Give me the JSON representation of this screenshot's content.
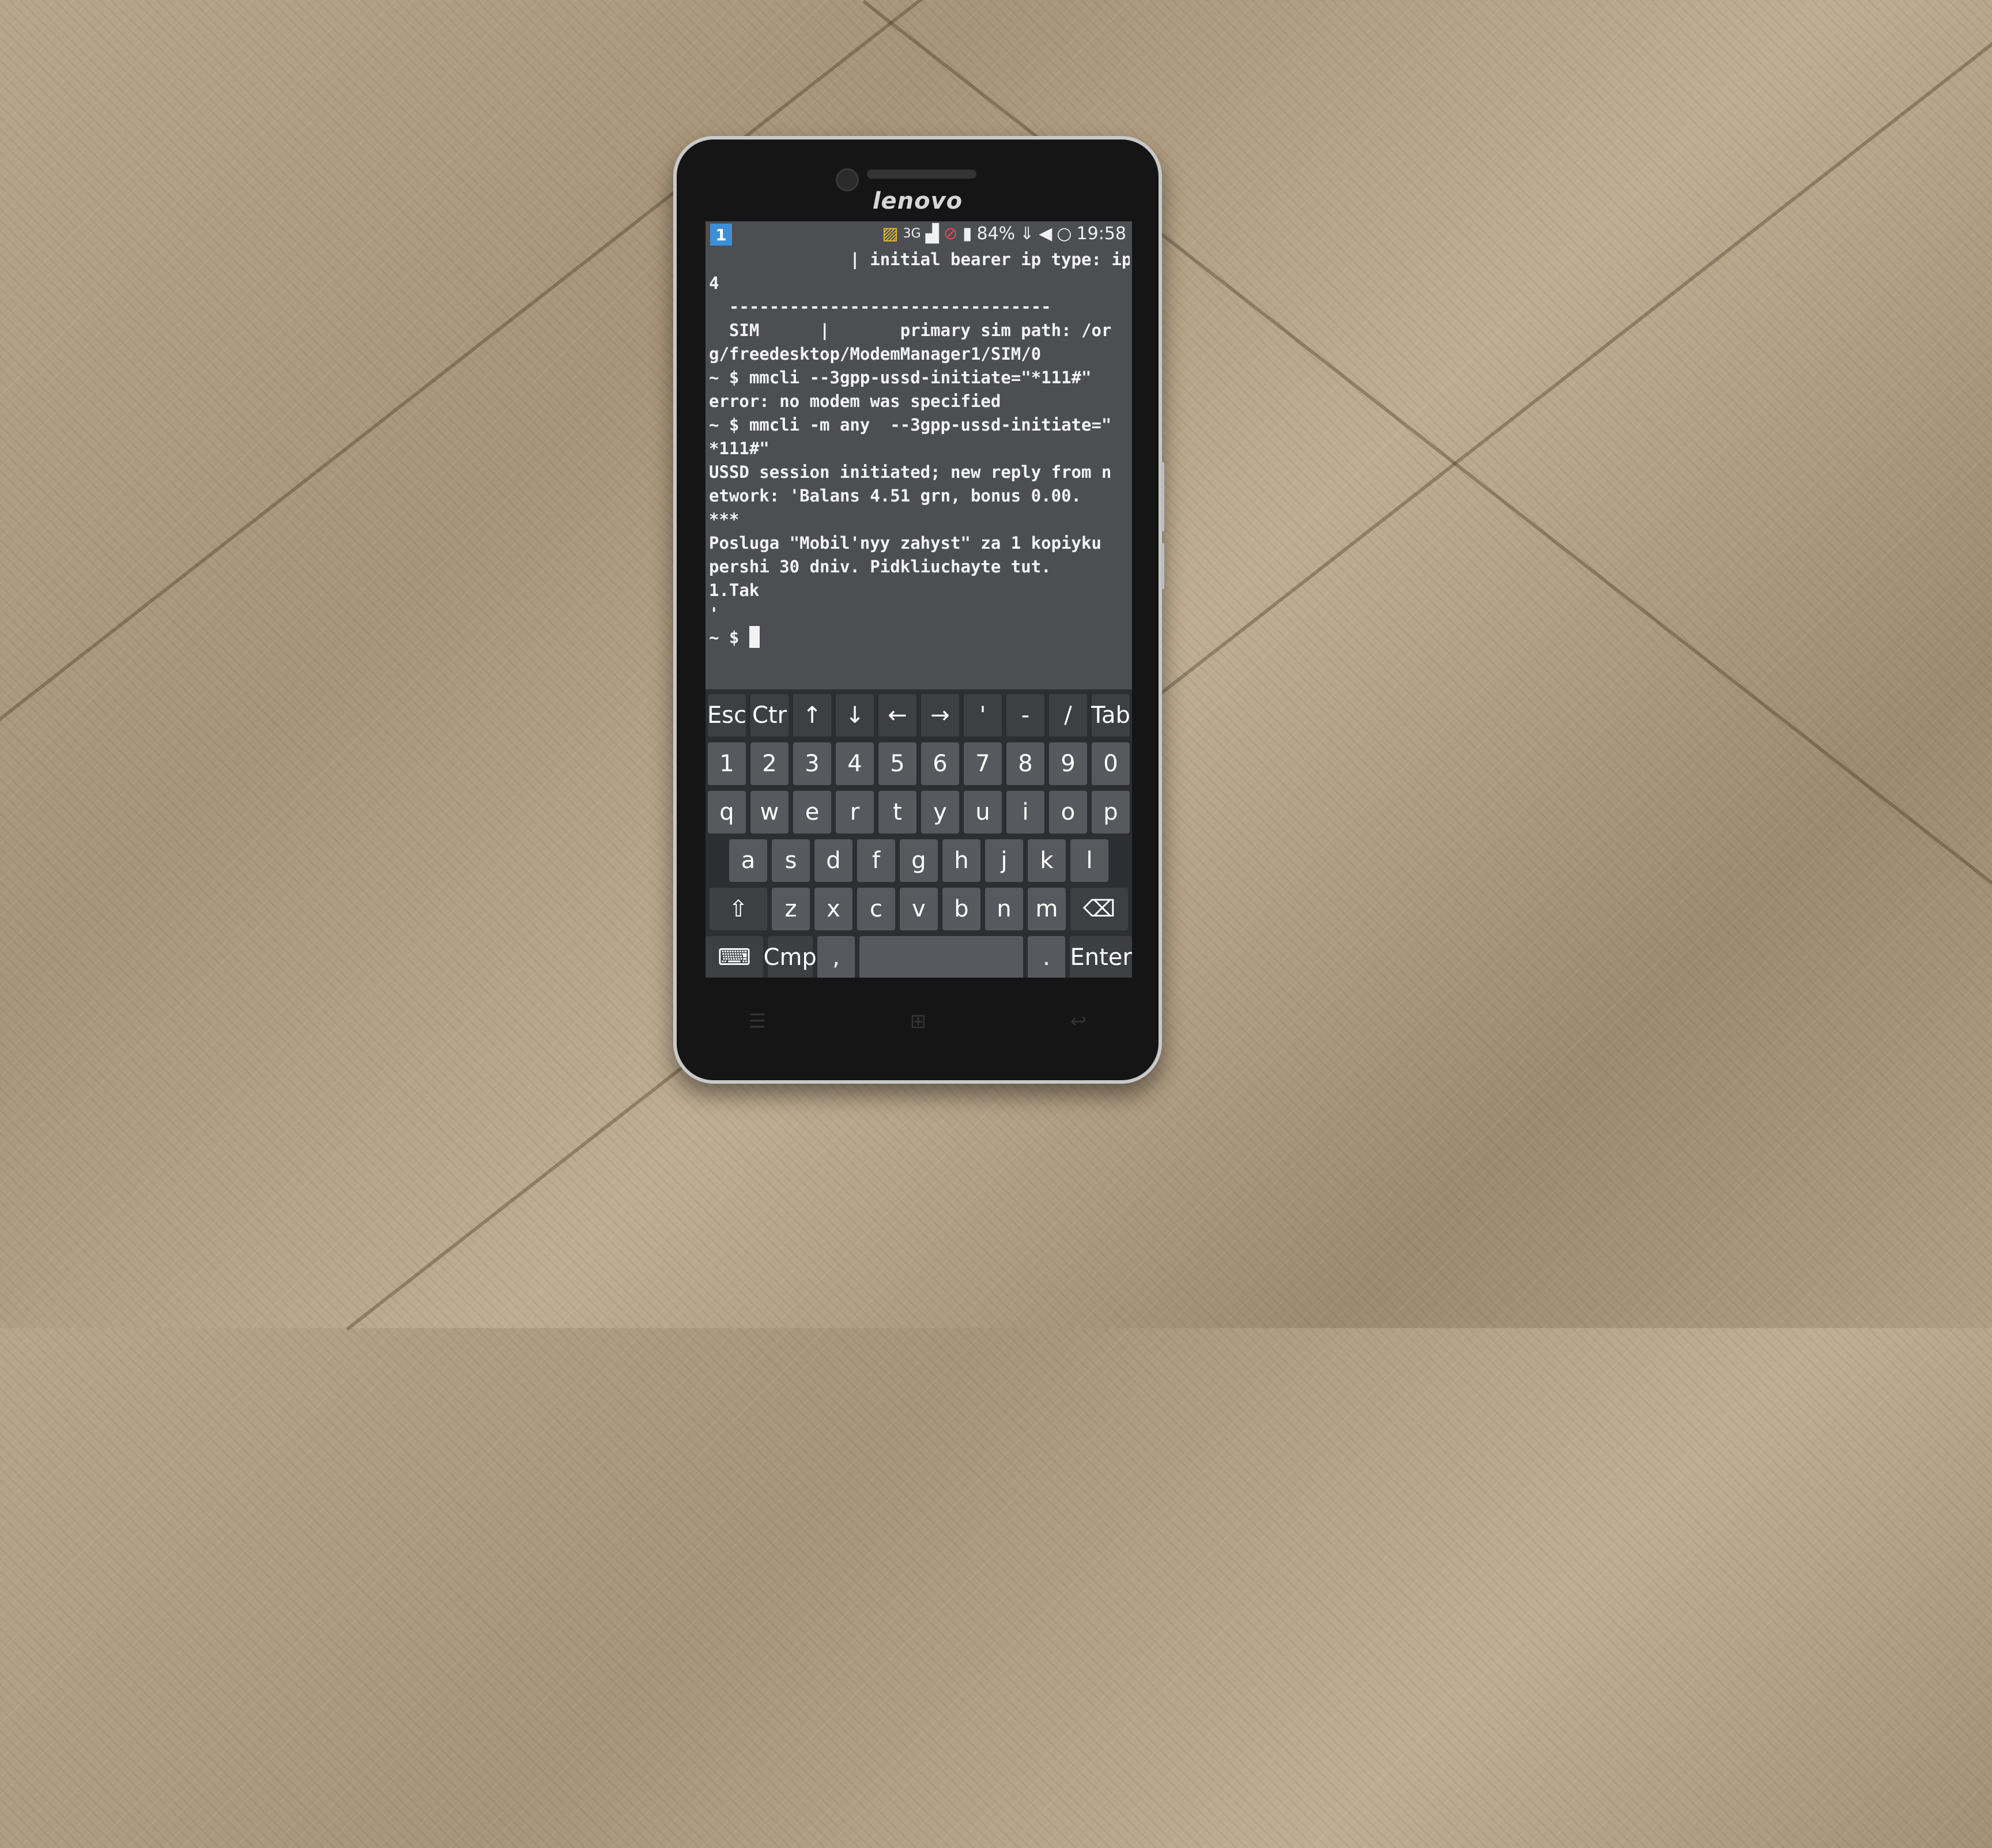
{
  "phone": {
    "brand": "lenovo"
  },
  "statusbar": {
    "window_number": "1",
    "network": "3G",
    "battery": "84%",
    "time": "19:58"
  },
  "terminal": {
    "lines": [
      "              | initial bearer ip type: ipv",
      "4",
      "  --------------------------------",
      "  SIM      |       primary sim path: /or",
      "g/freedesktop/ModemManager1/SIM/0",
      "~ $ mmcli --3gpp-ussd-initiate=\"*111#\"",
      "error: no modem was specified",
      "~ $ mmcli -m any  --3gpp-ussd-initiate=\"",
      "*111#\"",
      "USSD session initiated; new reply from n",
      "etwork: 'Balans 4.51 grn, bonus 0.00.",
      "***",
      "Posluga \"Mobil'nyy zahyst\" za 1 kopiyku",
      "pershi 30 dniv. Pidkliuchayte tut.",
      "1.Tak",
      "'"
    ],
    "prompt": "~ $ "
  },
  "keyboard": {
    "row_extra": [
      "Esc",
      "Ctr",
      "↑",
      "↓",
      "←",
      "→",
      "'",
      "-",
      "/",
      "Tab"
    ],
    "row_numbers": [
      "1",
      "2",
      "3",
      "4",
      "5",
      "6",
      "7",
      "8",
      "9",
      "0"
    ],
    "row_q": [
      "q",
      "w",
      "e",
      "r",
      "t",
      "y",
      "u",
      "i",
      "o",
      "p"
    ],
    "row_a": [
      "a",
      "s",
      "d",
      "f",
      "g",
      "h",
      "j",
      "k",
      "l"
    ],
    "row_z": [
      "⇧",
      "z",
      "x",
      "c",
      "v",
      "b",
      "n",
      "m",
      "⌫"
    ],
    "bottom": {
      "ime": "⌨",
      "compose": "Cmp",
      "comma": ",",
      "space": "",
      "period": ".",
      "enter": "Enter"
    }
  },
  "nav": {
    "menu_icon": "☰",
    "home_icon": "⊞",
    "back_icon": "↩"
  }
}
